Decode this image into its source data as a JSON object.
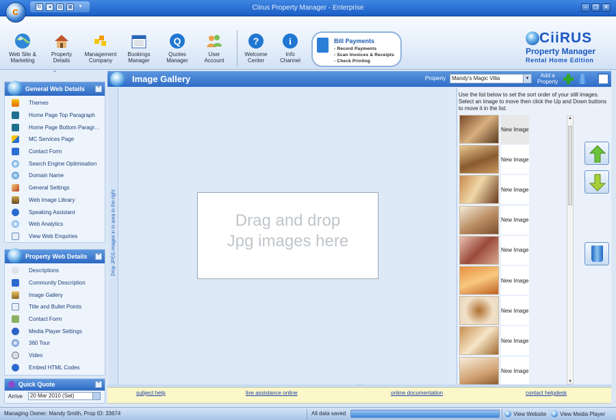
{
  "window": {
    "title": "Ciirus Property Manager  - Enterprise"
  },
  "ribbon": {
    "buttons": [
      {
        "line1": "Web Site &",
        "line2": "Marketing",
        "icon": "globe-icon"
      },
      {
        "line1": "Property",
        "line2": "Details",
        "icon": "house-icon"
      },
      {
        "line1": "Management",
        "line2": "Company",
        "icon": "company-icon"
      },
      {
        "line1": "Bookings",
        "line2": "Manager",
        "icon": "calendar-icon"
      },
      {
        "line1": "Quotes",
        "line2": "Manager",
        "icon": "quotes-icon"
      },
      {
        "line1": "User",
        "line2": "Account",
        "icon": "users-icon"
      },
      {
        "line1": "Welcome",
        "line2": "Center",
        "icon": "help-icon"
      },
      {
        "line1": "Info",
        "line2": "Channel",
        "icon": "info-icon"
      }
    ],
    "bill_payments": {
      "title": "Bill Payments",
      "lines": [
        "- Record Payments",
        "- Scan Invoices & Receipts",
        "- Check Printing"
      ]
    },
    "logo": {
      "brand": "CiiRUS",
      "product": "Property Manager",
      "edition": "Rental Home Edition"
    }
  },
  "sidebar": {
    "web_details": {
      "title": "General Web Details",
      "items": [
        "Themes",
        "Home Page Top Paragraph",
        "Home Page Bottom Paragr…",
        "MC Services Page",
        "Contact Form",
        "Search Engine Optimisation",
        "Domain Name",
        "General Settings",
        "Web Image Library",
        "Speaking Assistant",
        "Web Analytics",
        "View Web Enquiries"
      ]
    },
    "property_details": {
      "title": "Property Web Details",
      "items": [
        "Descriptions",
        "Community Description",
        "Image Gallery",
        "Title and Bullet Points",
        "Contact Form",
        "Media Player Settings",
        "360 Tour",
        "Video",
        "Embed HTML Codes"
      ]
    },
    "quick_quote": {
      "title": "Quick Quote",
      "arrive_label": "Arrive",
      "arrive_value": "20 Mar 2010 (Sat)"
    }
  },
  "panel": {
    "title": "Image Gallery",
    "property_label": "Property",
    "property_value": "Mandy's Magic Villa",
    "add_label_1": "Add a",
    "add_label_2": "Property",
    "vertical_hint": "Drop JPEG images in to area to the right.",
    "drop_line1": "Drag and drop",
    "drop_line2": "Jpg images here",
    "list_hint": "Use the list below to set the sort order of your still images. Select an image to move then click the Up and Down buttons to move it in the list.",
    "images": [
      "New Image",
      "New Image",
      "New Image",
      "New Image",
      "New Image",
      "New Image",
      "New Image",
      "New Image",
      "New Image"
    ]
  },
  "links": [
    "subject help",
    "live assistance online",
    "online documentation",
    "contact helpdesk"
  ],
  "status": {
    "owner": "Managing Owner: Mandy Smith, Prop ID: 33674",
    "saved": "All data saved",
    "progress": 1.0,
    "view_website": "View Website",
    "view_media_player": "View Media Player"
  }
}
